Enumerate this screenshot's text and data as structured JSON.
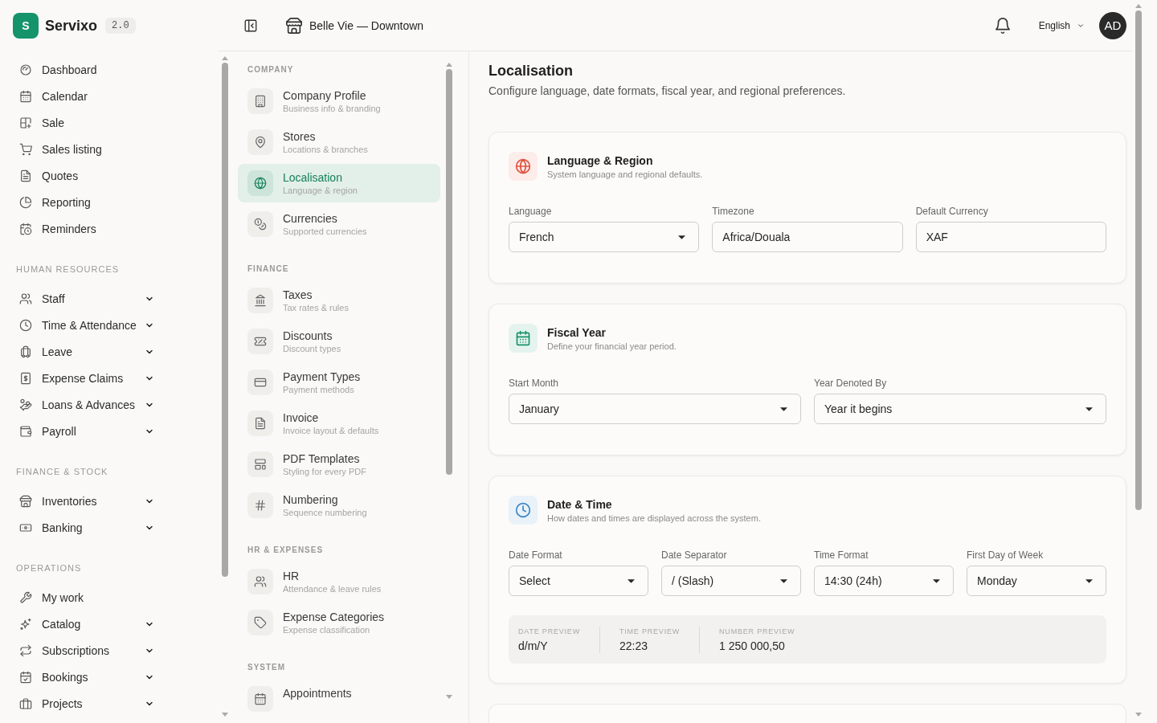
{
  "sidebar": {
    "logo": {
      "letter": "S",
      "name": "Servixo",
      "version": "2.0"
    },
    "sections": [
      {
        "items": [
          {
            "label": "Dashboard",
            "expandable": false,
            "selected": false
          },
          {
            "label": "Calendar",
            "expandable": false,
            "selected": false
          },
          {
            "label": "Sale",
            "expandable": false,
            "selected": false
          },
          {
            "label": "Sales listing",
            "expandable": false,
            "selected": false
          },
          {
            "label": "Quotes",
            "expandable": false,
            "selected": false
          },
          {
            "label": "Reporting",
            "expandable": false,
            "selected": false
          },
          {
            "label": "Reminders",
            "expandable": false,
            "selected": false
          }
        ]
      },
      {
        "title": "HUMAN RESOURCES",
        "items": [
          {
            "label": "Staff",
            "expandable": true,
            "selected": false
          },
          {
            "label": "Time & Attendance",
            "expandable": true,
            "selected": false
          },
          {
            "label": "Leave",
            "expandable": true,
            "selected": false
          },
          {
            "label": "Expense Claims",
            "expandable": true,
            "selected": false
          },
          {
            "label": "Loans & Advances",
            "expandable": true,
            "selected": false
          },
          {
            "label": "Payroll",
            "expandable": true,
            "selected": false
          }
        ]
      },
      {
        "title": "FINANCE & STOCK",
        "items": [
          {
            "label": "Inventories",
            "expandable": true,
            "selected": false
          },
          {
            "label": "Banking",
            "expandable": true,
            "selected": false
          }
        ]
      },
      {
        "title": "OPERATIONS",
        "items": [
          {
            "label": "My work",
            "expandable": false,
            "selected": false
          },
          {
            "label": "Catalog",
            "expandable": true,
            "selected": false
          },
          {
            "label": "Subscriptions",
            "expandable": true,
            "selected": false
          },
          {
            "label": "Bookings",
            "expandable": true,
            "selected": false
          },
          {
            "label": "Projects",
            "expandable": true,
            "selected": false
          }
        ]
      }
    ]
  },
  "header": {
    "store_name": "Belle Vie — Downtown",
    "language": "English",
    "avatar_initials": "AD"
  },
  "settings_nav": {
    "sections": [
      {
        "title": "COMPANY",
        "items": [
          {
            "title": "Company Profile",
            "subtitle": "Business info & branding",
            "selected": false
          },
          {
            "title": "Stores",
            "subtitle": "Locations & branches",
            "selected": false
          },
          {
            "title": "Localisation",
            "subtitle": "Language & region",
            "selected": true
          },
          {
            "title": "Currencies",
            "subtitle": "Supported currencies",
            "selected": false
          }
        ]
      },
      {
        "title": "FINANCE",
        "items": [
          {
            "title": "Taxes",
            "subtitle": "Tax rates & rules",
            "selected": false
          },
          {
            "title": "Discounts",
            "subtitle": "Discount types",
            "selected": false
          },
          {
            "title": "Payment Types",
            "subtitle": "Payment methods",
            "selected": false
          },
          {
            "title": "Invoice",
            "subtitle": "Invoice layout & defaults",
            "selected": false
          },
          {
            "title": "PDF Templates",
            "subtitle": "Styling for every PDF",
            "selected": false
          },
          {
            "title": "Numbering",
            "subtitle": "Sequence numbering",
            "selected": false
          }
        ]
      },
      {
        "title": "HR & EXPENSES",
        "items": [
          {
            "title": "HR",
            "subtitle": "Attendance & leave rules",
            "selected": false
          },
          {
            "title": "Expense Categories",
            "subtitle": "Expense classification",
            "selected": false
          }
        ]
      },
      {
        "title": "SYSTEM",
        "items": [
          {
            "title": "Appointments",
            "selected": false
          }
        ]
      }
    ]
  },
  "page": {
    "title": "Localisation",
    "description": "Configure language, date formats, fiscal year, and regional preferences."
  },
  "cards": [
    {
      "title": "Language & Region",
      "subtitle": "System language and regional defaults.",
      "color": "#e2543f",
      "fields": [
        {
          "label": "Language",
          "kind": "select",
          "value": "French"
        },
        {
          "label": "Timezone",
          "kind": "text",
          "value": "Africa/Douala"
        },
        {
          "label": "Default Currency",
          "kind": "text",
          "value": "XAF"
        }
      ]
    },
    {
      "title": "Fiscal Year",
      "subtitle": "Define your financial year period.",
      "color": "#17946a",
      "fields": [
        {
          "label": "Start Month",
          "kind": "select",
          "value": "January"
        },
        {
          "label": "Year Denoted By",
          "kind": "select",
          "value": "Year it begins"
        }
      ]
    },
    {
      "title": "Date & Time",
      "subtitle": "How dates and times are displayed across the system.",
      "color": "#3b86c6",
      "fields": [
        {
          "label": "Date Format",
          "kind": "select",
          "value": "Select"
        },
        {
          "label": "Date Separator",
          "kind": "select",
          "value": "/ (Slash)"
        },
        {
          "label": "Time Format",
          "kind": "select",
          "value": "14:30 (24h)"
        },
        {
          "label": "First Day of Week",
          "kind": "select",
          "value": "Monday"
        }
      ],
      "preview": [
        {
          "label": "DATE PREVIEW",
          "value": "d/m/Y"
        },
        {
          "label": "TIME PREVIEW",
          "value": "22:23"
        },
        {
          "label": "NUMBER PREVIEW",
          "value": "1 250 000,50"
        }
      ]
    }
  ]
}
